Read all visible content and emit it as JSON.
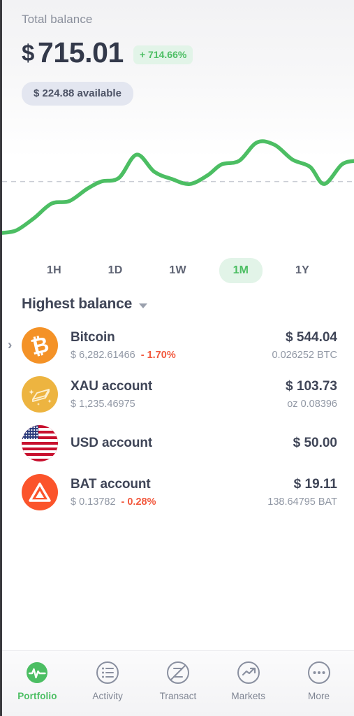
{
  "header": {
    "total_label": "Total balance",
    "currency_symbol": "$",
    "balance": "715.01",
    "change_badge": "+ 714.66%",
    "available_chip": "$ 224.88 available",
    "accent_green": "#4CBE63",
    "badge_bg": "#E2F4E8",
    "chip_bg": "#E3E6F0",
    "text_dark": "#3F4557"
  },
  "chart_data": {
    "type": "line",
    "title": "Total balance history",
    "series_name": "Total balance",
    "line_color": "#4CBE63",
    "baseline_color": "#C9CCD4",
    "baseline_style": "dashed",
    "grid": false,
    "legend": false,
    "xlabel": "",
    "ylabel": "",
    "selected_range": "1M",
    "baseline_y": 0,
    "x": [
      0,
      4,
      9,
      14,
      19,
      24,
      28,
      33,
      38,
      43,
      48,
      53,
      58,
      62,
      67,
      72,
      77,
      82,
      87,
      91,
      96,
      100
    ],
    "y": [
      -42,
      -40,
      -30,
      -18,
      -16,
      -6,
      0,
      3,
      22,
      8,
      2,
      -2,
      5,
      14,
      17,
      32,
      30,
      18,
      12,
      -2,
      14,
      17
    ],
    "ylim": [
      -50,
      45
    ],
    "xlim": [
      0,
      100
    ]
  },
  "ranges": {
    "items": [
      {
        "label": "1H",
        "active": false
      },
      {
        "label": "1D",
        "active": false
      },
      {
        "label": "1W",
        "active": false
      },
      {
        "label": "1M",
        "active": true
      },
      {
        "label": "1Y",
        "active": false
      }
    ]
  },
  "list": {
    "sort_label": "Highest balance",
    "rows": [
      {
        "name": "Bitcoin",
        "price": "$ 6,282.61466",
        "change": "- 1.70%",
        "change_dir": "neg",
        "fiat": "$ 544.04",
        "native": "0.026252 BTC",
        "icon": "bitcoin-icon",
        "icon_bg": "#F49227",
        "has_chevron": true
      },
      {
        "name": "XAU account",
        "price": "$ 1,235.46975",
        "change": "",
        "change_dir": "",
        "fiat": "$ 103.73",
        "native": "oz 0.08396",
        "icon": "gold-bar-icon",
        "icon_bg": "#EDB440",
        "has_chevron": false
      },
      {
        "name": "USD account",
        "price": "",
        "change": "",
        "change_dir": "",
        "fiat": "$ 50.00",
        "native": "",
        "icon": "us-flag-icon",
        "icon_bg": "#C8102E",
        "has_chevron": false
      },
      {
        "name": "BAT account",
        "price": "$ 0.13782",
        "change": "- 0.28%",
        "change_dir": "neg",
        "fiat": "$ 19.11",
        "native": "138.64795 BAT",
        "icon": "bat-triangle-icon",
        "icon_bg": "#FB542B",
        "has_chevron": false
      }
    ]
  },
  "bottom_nav": {
    "items": [
      {
        "label": "Portfolio",
        "icon": "pulse-circle-icon",
        "active": true
      },
      {
        "label": "Activity",
        "icon": "list-circle-icon",
        "active": false
      },
      {
        "label": "Transact",
        "icon": "zed-circle-icon",
        "active": false
      },
      {
        "label": "Markets",
        "icon": "trend-up-circle-icon",
        "active": false
      },
      {
        "label": "More",
        "icon": "ellipsis-circle-icon",
        "active": false
      }
    ]
  }
}
